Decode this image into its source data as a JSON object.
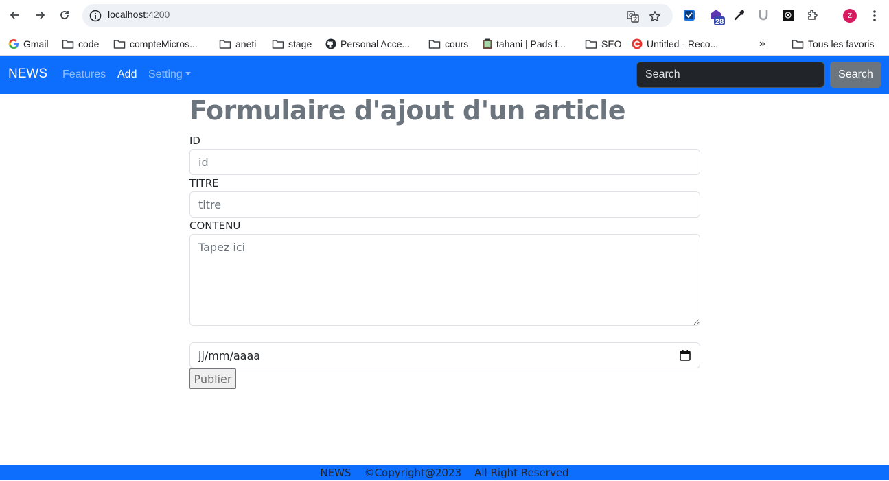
{
  "browser": {
    "url_host": "localhost",
    "url_port": ":4200",
    "extension_badge": "28",
    "profile_initial": "Z",
    "bookmarks": [
      {
        "label": "Gmail",
        "icon": "google-icon"
      },
      {
        "label": "code",
        "icon": "folder-icon"
      },
      {
        "label": "compteMicros...",
        "icon": "folder-icon"
      },
      {
        "label": "aneti",
        "icon": "folder-icon"
      },
      {
        "label": "stage",
        "icon": "folder-icon"
      },
      {
        "label": "Personal Acce...",
        "icon": "github-icon"
      },
      {
        "label": "cours",
        "icon": "folder-icon"
      },
      {
        "label": "tahani | Pads f...",
        "icon": "pad-icon"
      },
      {
        "label": "SEO",
        "icon": "folder-icon"
      },
      {
        "label": "Untitled - Reco...",
        "icon": "record-icon"
      }
    ],
    "more_bookmarks": "»",
    "all_bookmarks": "Tous les favoris"
  },
  "navbar": {
    "brand": "NEWS",
    "links": [
      "Features",
      "Add",
      "Setting"
    ],
    "search_placeholder": "Search",
    "search_button": "Search"
  },
  "form": {
    "title": "Formulaire d'ajout d'un article",
    "id_label": "ID",
    "id_placeholder": "id",
    "titre_label": "TITRE",
    "titre_placeholder": "titre",
    "contenu_label": "CONTENU",
    "contenu_placeholder": "Tapez ici",
    "date_placeholder": "jj/mm/aaaa",
    "submit": "Publier"
  },
  "footer": {
    "brand": "NEWS",
    "copyright": "©Copyright@2023",
    "rights": "All Right Reserved"
  },
  "colors": {
    "navbar": "#0d6efd",
    "title": "#6c757d",
    "search_button": "#6c757d"
  }
}
